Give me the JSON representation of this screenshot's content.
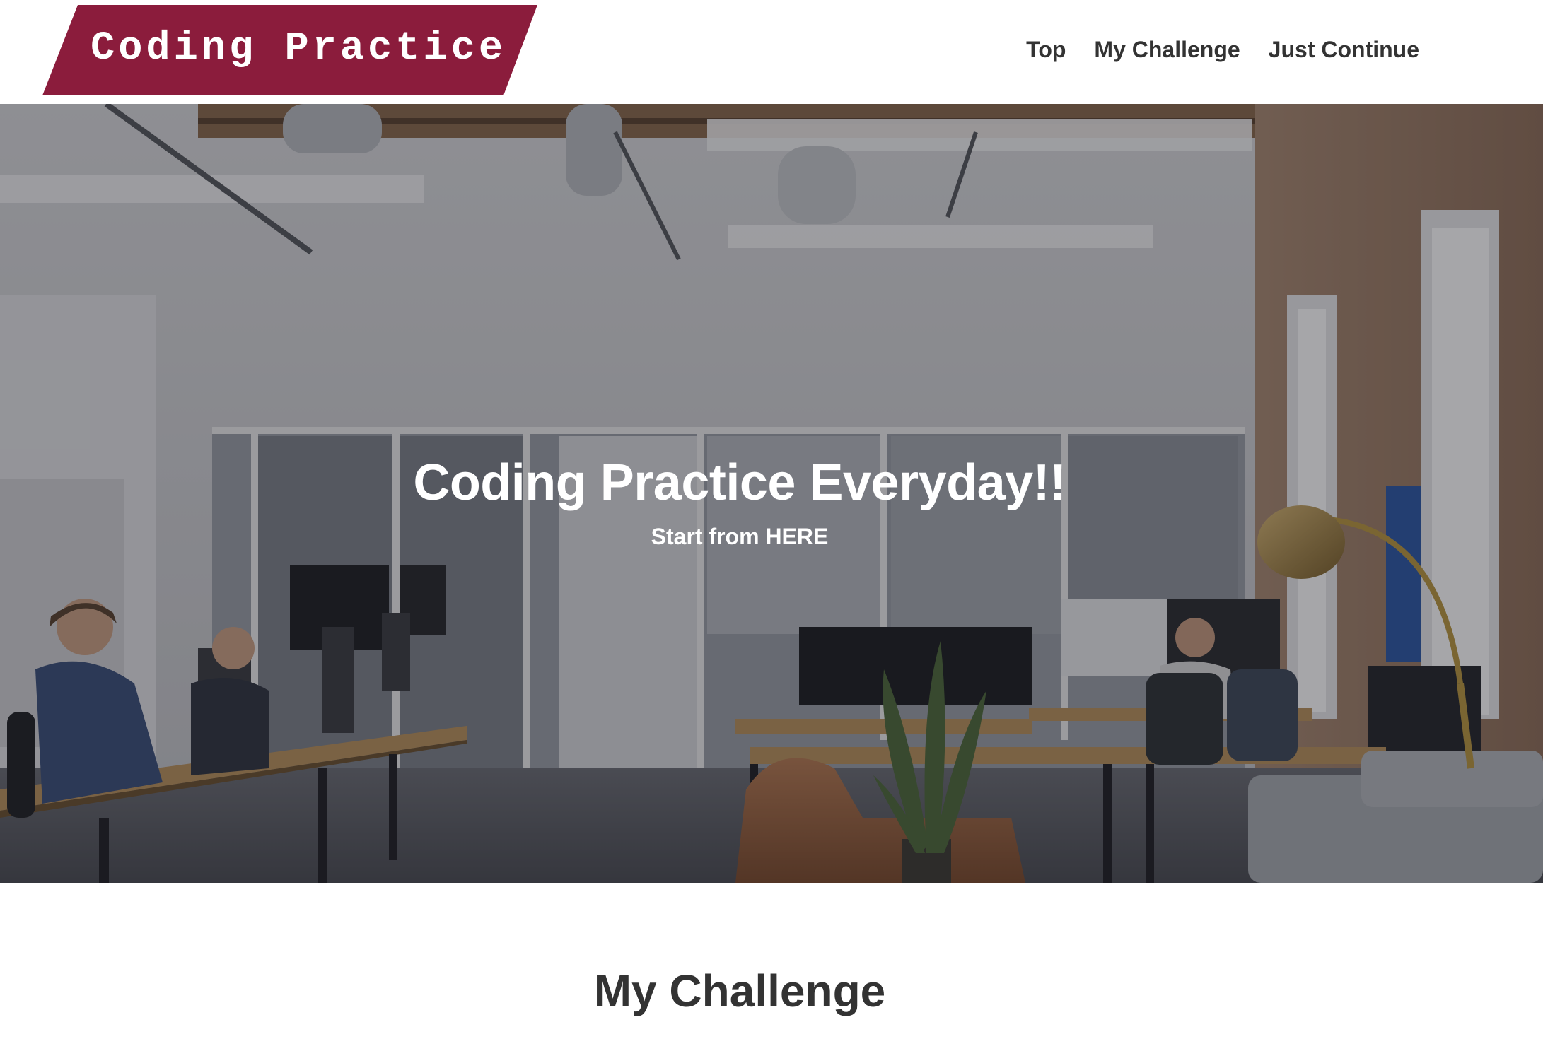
{
  "header": {
    "logo_text": "Coding Practice",
    "nav": [
      {
        "label": "Top"
      },
      {
        "label": "My Challenge"
      },
      {
        "label": "Just Continue"
      }
    ]
  },
  "hero": {
    "title": "Coding Practice Everyday!!",
    "subtitle": "Start from HERE",
    "background_image": "office-interior-photo"
  },
  "sections": {
    "challenge_title": "My Challenge"
  },
  "colors": {
    "brand": "#8b1c3c",
    "text": "#333333",
    "hero_text": "#ffffff",
    "background": "#ffffff"
  }
}
